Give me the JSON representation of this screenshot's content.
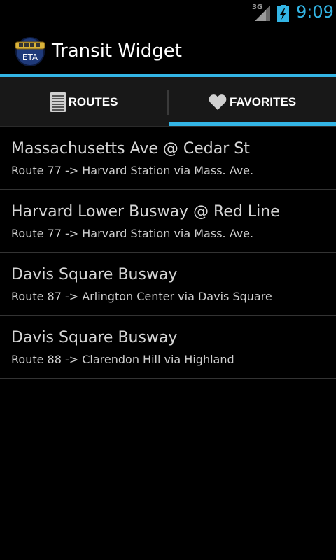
{
  "status_bar": {
    "network_label": "3G",
    "time": "9:09",
    "accent_color": "#33b5e5"
  },
  "action_bar": {
    "app_icon_text": "ETA",
    "title": "Transit Widget"
  },
  "tabs": [
    {
      "label": "ROUTES",
      "icon": "list-icon",
      "selected": false
    },
    {
      "label": "FAVORITES",
      "icon": "heart-icon",
      "selected": true
    }
  ],
  "favorites": [
    {
      "stop": "Massachusetts Ave @ Cedar St",
      "route": "Route 77 -> Harvard Station via Mass. Ave."
    },
    {
      "stop": "Harvard Lower Busway @ Red Line",
      "route": "Route 77 -> Harvard Station via Mass. Ave."
    },
    {
      "stop": "Davis Square Busway",
      "route": "Route 87 -> Arlington Center via Davis Square"
    },
    {
      "stop": "Davis Square Busway",
      "route": "Route 88 -> Clarendon Hill via Highland"
    }
  ]
}
